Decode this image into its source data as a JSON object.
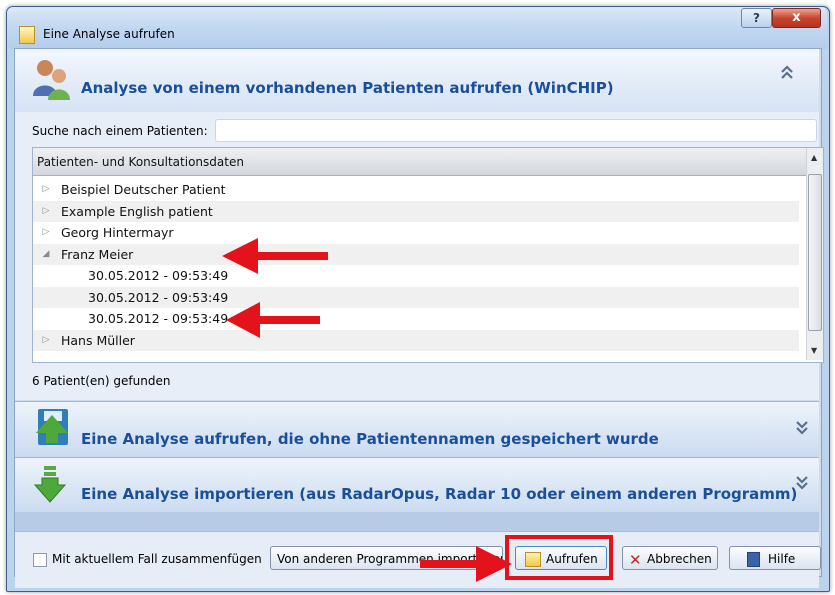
{
  "window": {
    "title": "Eine Analyse aufrufen",
    "help_glyph": "?",
    "close_glyph": "x"
  },
  "section_existing": {
    "title": "Analyse von einem vorhandenen Patienten aufrufen (WinCHIP)",
    "collapse_glyph": "⌃⌃",
    "search_label": "Suche nach einem Patienten:",
    "search_value": "",
    "tree_header": "Patienten- und Konsultationsdaten",
    "rows": [
      {
        "label": "Beispiel Deutscher Patient",
        "expanded": false,
        "level": 0
      },
      {
        "label": "Example English patient",
        "expanded": false,
        "level": 0
      },
      {
        "label": "Georg Hintermayr",
        "expanded": false,
        "level": 0
      },
      {
        "label": "Franz Meier",
        "expanded": true,
        "level": 0
      },
      {
        "label": "30.05.2012 - 09:53:49",
        "level": 1
      },
      {
        "label": "30.05.2012 - 09:53:49",
        "level": 1
      },
      {
        "label": "30.05.2012 - 09:53:49",
        "level": 1
      },
      {
        "label": "Hans Müller",
        "expanded": false,
        "level": 0
      }
    ],
    "found_text": "6 Patient(en) gefunden"
  },
  "section_unnamed": {
    "title": "Eine Analyse aufrufen, die ohne Patientennamen gespeichert wurde",
    "expand_glyph": "⌄⌄"
  },
  "section_import": {
    "title": "Eine Analyse importieren (aus RadarOpus, Radar 10 oder einem anderen Programm)",
    "expand_glyph": "⌄⌄"
  },
  "bottom": {
    "merge_label": "Mit aktuellem Fall zusammenfügen",
    "import_button": "Von anderen Programmen importieren",
    "open_button": "Aufrufen",
    "cancel_button": "Abbrechen",
    "help_button": "Hilfe"
  },
  "colors": {
    "title_blue": "#1a4f9a",
    "annotation_red": "#e3121b"
  },
  "icons": [
    "people-icon",
    "save-disk-icon",
    "import-arrow-icon",
    "folder-icon",
    "cancel-x-icon",
    "help-book-icon"
  ]
}
